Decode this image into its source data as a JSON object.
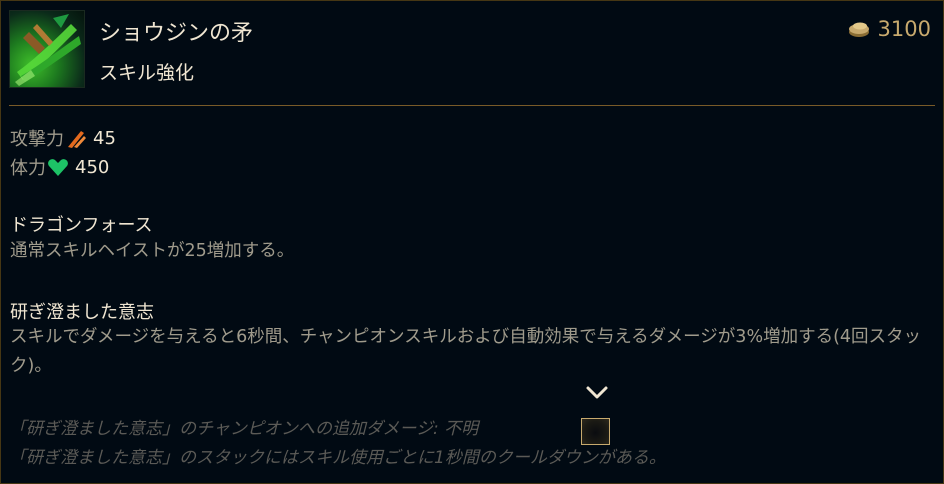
{
  "item": {
    "name": "ショウジンの矛",
    "subtitle": "スキル強化",
    "icon": "shojin-spear-icon",
    "cost": "3100",
    "cost_icon": "gold-coin-icon"
  },
  "stats": [
    {
      "label": "攻撃力",
      "icon": "attack-damage-icon",
      "value": "45",
      "icon_color": "#e36a1e"
    },
    {
      "label": "体力",
      "icon": "health-heart-icon",
      "value": "450",
      "icon_color": "#1dc266"
    }
  ],
  "passives": [
    {
      "name": "ドラゴンフォース",
      "description": "通常スキルヘイストが25増加する。"
    },
    {
      "name": "研ぎ澄ました意志",
      "description": "スキルでダメージを与えると6秒間、チャンピオンスキルおよび自動効果で与えるダメージが3%増加する(4回スタック)。"
    }
  ],
  "notes": [
    "「研ぎ澄ました意志」のチャンピオンへの追加ダメージ: 不明",
    "「研ぎ澄ました意志」のスタックにはスキル使用ごとに1秒間のクールダウンがある。"
  ],
  "colors": {
    "background": "#010a13",
    "gold": "#c8aa6e",
    "title": "#f0e6d2",
    "body_text": "#a09b8c",
    "muted_text": "#5b5a56"
  }
}
